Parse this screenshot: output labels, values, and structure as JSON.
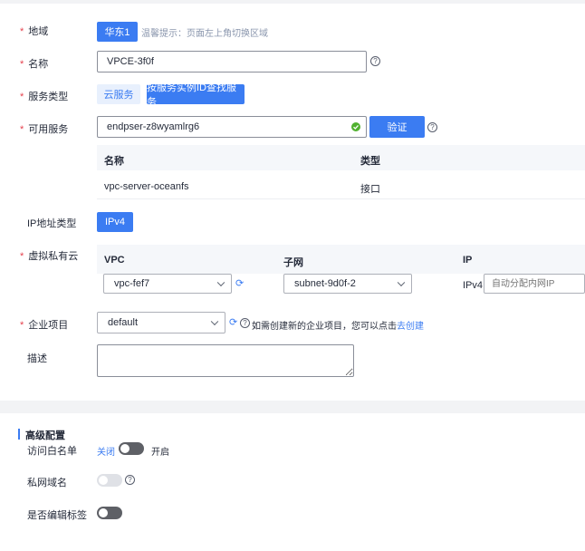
{
  "form": {
    "region": {
      "label": "地域",
      "value": "华东1",
      "tip": "温馨提示：页面左上角切换区域"
    },
    "name": {
      "label": "名称",
      "value": "VPCE-3f0f"
    },
    "service_type": {
      "label": "服务类型",
      "option1": "云服务",
      "option2": "按服务实例ID查找服务"
    },
    "available_service": {
      "label": "可用服务",
      "value": "endpser-z8wyamlrg6",
      "verify_label": "验证",
      "table": {
        "headers": [
          "名称",
          "类型"
        ],
        "rows": [
          [
            "vpc-server-oceanfs",
            "接口"
          ]
        ]
      }
    },
    "ip_type": {
      "label": "IP地址类型",
      "value": "IPv4"
    },
    "vpc": {
      "label": "虚拟私有云",
      "headers": [
        "VPC",
        "子网",
        "IP"
      ],
      "vpc_value": "vpc-fef7",
      "subnet_value": "subnet-9d0f-2",
      "ip_prefix": "IPv4:",
      "ip_placeholder": "自动分配内网IP"
    },
    "enterprise_project": {
      "label": "企业项目",
      "value": "default",
      "hint": "如需创建新的企业项目，您可以点击",
      "link": "去创建"
    },
    "description": {
      "label": "描述",
      "value": ""
    }
  },
  "advanced": {
    "title": "高级配置",
    "whitelist": {
      "label": "访问白名单",
      "off_label": "关闭",
      "on_label": "开启",
      "enabled": false
    },
    "private_dns": {
      "label": "私网域名",
      "enabled": false,
      "disabled": true
    },
    "edit_tags": {
      "label": "是否编辑标签",
      "enabled": false
    }
  },
  "colors": {
    "primary": "#3b7cf2",
    "required": "#e6424e",
    "success": "#50b12f"
  }
}
